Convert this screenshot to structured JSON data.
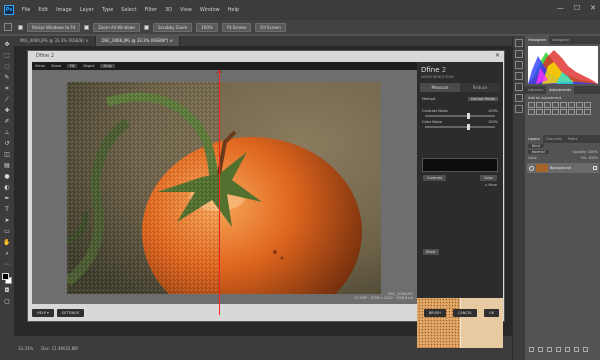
{
  "menubar": {
    "logo": "Ps",
    "items": [
      "File",
      "Edit",
      "Image",
      "Layer",
      "Type",
      "Select",
      "Filter",
      "3D",
      "View",
      "Window",
      "Help"
    ]
  },
  "window_controls": {
    "minimize": "—",
    "maximize": "☐",
    "close": "✕"
  },
  "optionsbar": {
    "buttons": [
      "Resize Windows to Fit",
      "Zoom All Windows",
      "Scrubby Zoom",
      "100%",
      "Fit Screen",
      "Fill Screen"
    ]
  },
  "doctabs": [
    {
      "label": "IMG_4060.JPG @ 33.3% (RGB/8) ×",
      "active": false
    },
    {
      "label": "DSC_0066.JPG @ 33.3% (RGB/8*) ×",
      "active": true
    }
  ],
  "statusbar": {
    "zoom": "33.33%",
    "doc": "Doc: 11.4M/22.8M"
  },
  "dfine": {
    "title": "Dfine 2",
    "close": "✕",
    "bar": {
      "views": "Views",
      "zoom_label": "Zoom",
      "zoom_value": "Fit",
      "bkgnd_label": "Bkgnd",
      "bkgnd_value": "Gray"
    },
    "photo_info": {
      "filename": "DSC_0066.JPG",
      "size": "12.3MP · 4256 × 2832 · RGB 8 bit"
    },
    "panel": {
      "logo": "Dfine",
      "logo_version": "2",
      "subtitle": "NOISE REDUCTION",
      "tabs": [
        "Measure",
        "Reduce"
      ],
      "method_label": "Method",
      "method_value": "Control Points",
      "contrast_label": "Contrast Noise",
      "contrast_value": "100%",
      "color_label": "Color Noise",
      "color_value": "100%",
      "btn_left": "Contrast",
      "btn_right": "Color",
      "more": "▸ More",
      "reset": "Reset",
      "loupe_label": "▾ Loupe"
    },
    "bottom": {
      "help": "HELP ▾",
      "settings": "SETTINGS",
      "brush": "BRUSH",
      "cancel": "CANCEL",
      "ok": "OK"
    }
  },
  "right_panel": {
    "hist_tabs": [
      "Histogram",
      "Navigator"
    ],
    "adj_tabs": [
      "Libraries",
      "Adjustments"
    ],
    "adj_title": "Add an adjustment",
    "layer_tabs": [
      "Layers",
      "Channels",
      "Paths"
    ],
    "kind_label": "Kind",
    "blend_mode": "Normal",
    "opacity_label": "Opacity: 100%",
    "lock_label": "Lock:",
    "fill_label": "Fill: 100%",
    "layer_name": "Background"
  },
  "colors": {
    "accent": "#31a8ff",
    "split": "#ff2020",
    "panel_dark": "#2c2c2c"
  }
}
